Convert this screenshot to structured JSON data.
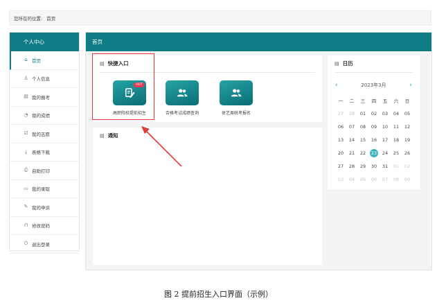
{
  "breadcrumb": {
    "prefix": "您所在的位置:",
    "current": "首页"
  },
  "sidebar": {
    "title": "个人中心",
    "items": [
      {
        "label": "首页",
        "icon": "home-icon",
        "active": true
      },
      {
        "label": "个人信息",
        "icon": "user-icon"
      },
      {
        "label": "我的报考",
        "icon": "book-icon"
      },
      {
        "label": "我的成绩",
        "icon": "chart-icon"
      },
      {
        "label": "我的志愿",
        "icon": "checklist-icon"
      },
      {
        "label": "表格下载",
        "icon": "download-icon"
      },
      {
        "label": "自助打印",
        "icon": "printer-icon"
      },
      {
        "label": "我的录取",
        "icon": "calendar-icon"
      },
      {
        "label": "我的申诉",
        "icon": "edit-icon"
      },
      {
        "label": "修改密码",
        "icon": "lock-icon"
      },
      {
        "label": "退出登录",
        "icon": "logout-icon"
      }
    ]
  },
  "main": {
    "title": "首页",
    "quick_entry": {
      "title": "快捷入口",
      "tiles": [
        {
          "label": "高职院校提前招生",
          "icon": "edit-document-icon",
          "badge": "HOT"
        },
        {
          "label": "合格考试成绩查询",
          "icon": "users-icon"
        },
        {
          "label": "体艺类统考报名",
          "icon": "users-icon"
        }
      ]
    },
    "notice": {
      "title": "通知"
    }
  },
  "calendar": {
    "title": "日历",
    "month_label": "2023年3月",
    "weekdays": [
      "一",
      "二",
      "三",
      "四",
      "五",
      "六",
      "日"
    ],
    "days": [
      {
        "d": "27",
        "m": true
      },
      {
        "d": "28",
        "m": true
      },
      {
        "d": "01"
      },
      {
        "d": "02"
      },
      {
        "d": "03"
      },
      {
        "d": "04"
      },
      {
        "d": "05"
      },
      {
        "d": "06"
      },
      {
        "d": "07"
      },
      {
        "d": "08"
      },
      {
        "d": "09"
      },
      {
        "d": "10"
      },
      {
        "d": "11"
      },
      {
        "d": "12"
      },
      {
        "d": "13"
      },
      {
        "d": "14"
      },
      {
        "d": "15"
      },
      {
        "d": "16"
      },
      {
        "d": "17"
      },
      {
        "d": "18"
      },
      {
        "d": "19"
      },
      {
        "d": "20"
      },
      {
        "d": "21"
      },
      {
        "d": "22"
      },
      {
        "d": "23",
        "today": true
      },
      {
        "d": "24"
      },
      {
        "d": "25"
      },
      {
        "d": "26"
      },
      {
        "d": "27"
      },
      {
        "d": "28"
      },
      {
        "d": "29"
      },
      {
        "d": "30"
      },
      {
        "d": "31"
      },
      {
        "d": "01",
        "m": true
      },
      {
        "d": "02",
        "m": true
      },
      {
        "d": "03",
        "m": true
      },
      {
        "d": "04",
        "m": true
      },
      {
        "d": "05",
        "m": true
      },
      {
        "d": "06",
        "m": true
      },
      {
        "d": "07",
        "m": true
      },
      {
        "d": "08",
        "m": true
      },
      {
        "d": "09",
        "m": true
      }
    ]
  },
  "caption": "图 2  提前招生入口界面（示例）",
  "colors": {
    "primary": "#0f7d86",
    "today": "#3fb3c0",
    "highlight": "#e53935"
  }
}
